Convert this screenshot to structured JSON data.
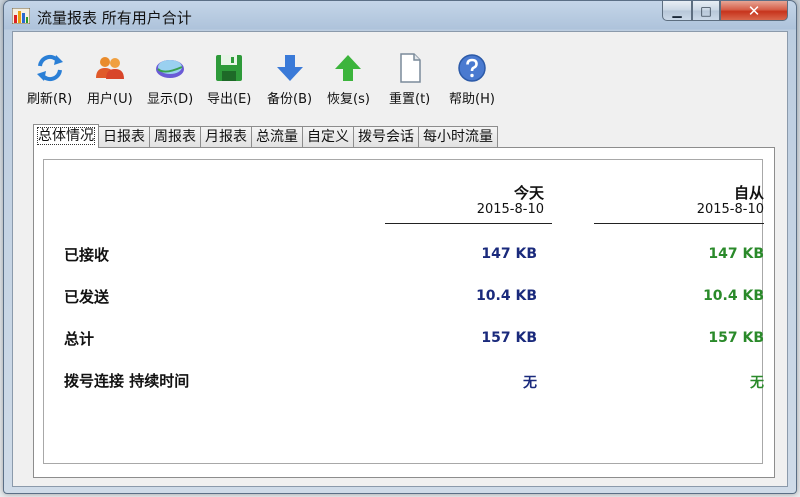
{
  "window": {
    "title": "流量报表 所有用户合计",
    "controls": {
      "minimize": "▁",
      "maximize": "□",
      "close": "✕"
    }
  },
  "toolbar": {
    "items": [
      {
        "label": "刷新(R)",
        "icon": "refresh-icon"
      },
      {
        "label": "用户(U)",
        "icon": "users-icon"
      },
      {
        "label": "显示(D)",
        "icon": "display-icon"
      },
      {
        "label": "导出(E)",
        "icon": "save-disk-icon"
      },
      {
        "label": "备份(B)",
        "icon": "arrow-down-icon"
      },
      {
        "label": "恢复(s)",
        "icon": "arrow-up-icon"
      },
      {
        "label": "重置(t)",
        "icon": "blank-page-icon"
      },
      {
        "label": "帮助(H)",
        "icon": "help-icon"
      }
    ]
  },
  "tabs": [
    {
      "label": "总体情况",
      "active": true
    },
    {
      "label": "日报表"
    },
    {
      "label": "周报表"
    },
    {
      "label": "月报表"
    },
    {
      "label": "总流量"
    },
    {
      "label": "自定义"
    },
    {
      "label": "拨号会话"
    },
    {
      "label": "每小时流量"
    }
  ],
  "summary": {
    "columns": {
      "today": {
        "header": "今天",
        "date": "2015-8-10"
      },
      "since": {
        "header": "自从",
        "date": "2015-8-10"
      }
    },
    "rows": [
      {
        "label": "已接收",
        "today": "147 KB",
        "since": "147 KB"
      },
      {
        "label": "已发送",
        "today": "10.4 KB",
        "since": "10.4 KB"
      },
      {
        "label": "总计",
        "today": "157 KB",
        "since": "157 KB"
      },
      {
        "label": "拨号连接 持续时间",
        "today": "无",
        "since": "无"
      }
    ]
  },
  "colors": {
    "today_value": "#1a2a7c",
    "since_value": "#2a8a2a",
    "close_button": "#c7341c"
  }
}
